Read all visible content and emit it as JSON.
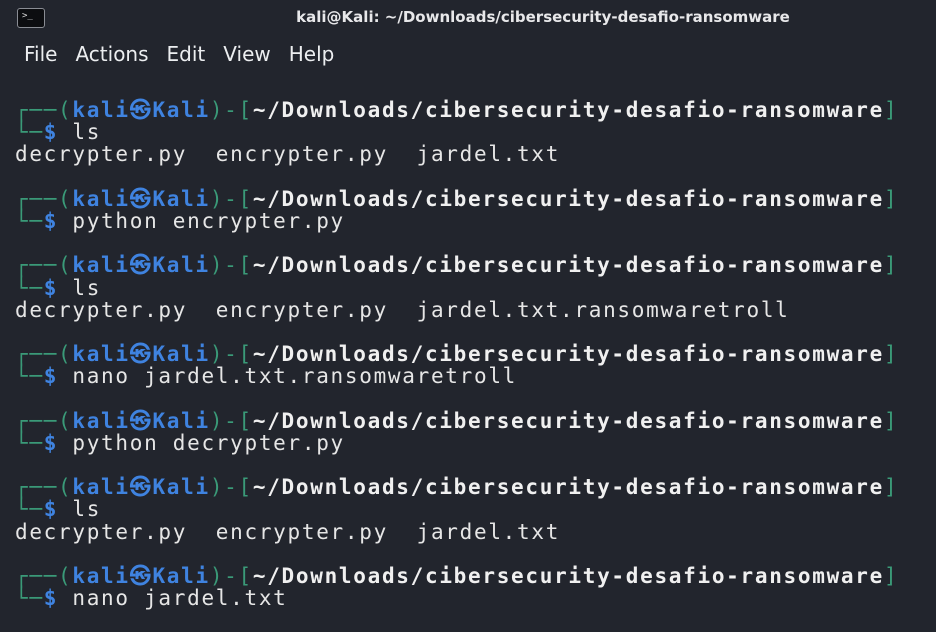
{
  "window": {
    "title": "kali@Kali: ~/Downloads/cibersecurity-desafio-ransomware",
    "icon": "terminal-icon"
  },
  "menu": [
    "File",
    "Actions",
    "Edit",
    "View",
    "Help"
  ],
  "prompt": {
    "user": "kali",
    "at": "㉿",
    "host": "Kali",
    "cwd": "~/Downloads/cibersecurity-desafio-ransomware",
    "symbol": "$"
  },
  "session": [
    {
      "command": "ls",
      "output": "decrypter.py  encrypter.py  jardel.txt"
    },
    {
      "command": "python encrypter.py",
      "output": null
    },
    {
      "command": "ls",
      "output": "decrypter.py  encrypter.py  jardel.txt.ransomwaretroll"
    },
    {
      "command": "nano jardel.txt.ransomwaretroll",
      "output": null
    },
    {
      "command": "python decrypter.py",
      "output": null
    },
    {
      "command": "ls",
      "output": "decrypter.py  encrypter.py  jardel.txt"
    },
    {
      "command": "nano jardel.txt",
      "output": null
    }
  ]
}
